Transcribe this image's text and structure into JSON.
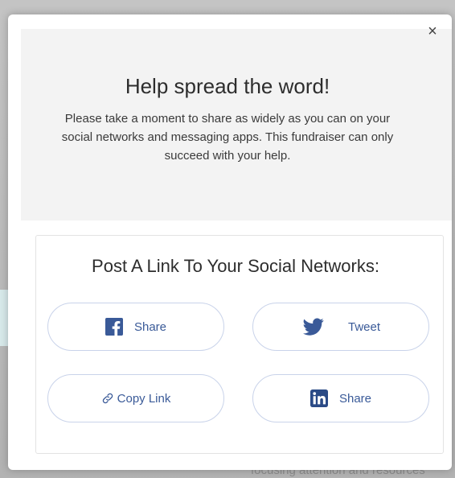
{
  "modal": {
    "close_symbol": "×",
    "title": "Help spread the word!",
    "subtitle": "Please take a moment to share as widely as you can on your social networks and messaging apps. This fundraiser can only succeed with your help."
  },
  "share_card": {
    "title": "Post A Link To Your Social Networks:",
    "buttons": [
      {
        "icon": "facebook-icon",
        "label": "Share"
      },
      {
        "icon": "twitter-icon",
        "label": "Tweet"
      },
      {
        "icon": "link-icon",
        "label": "Copy Link"
      },
      {
        "icon": "linkedin-icon",
        "label": "Share"
      }
    ]
  },
  "background": {
    "partial_text": "focusing attention and resources"
  },
  "colors": {
    "brand_blue": "#3a5a98",
    "button_border": "#c9d3ea"
  }
}
